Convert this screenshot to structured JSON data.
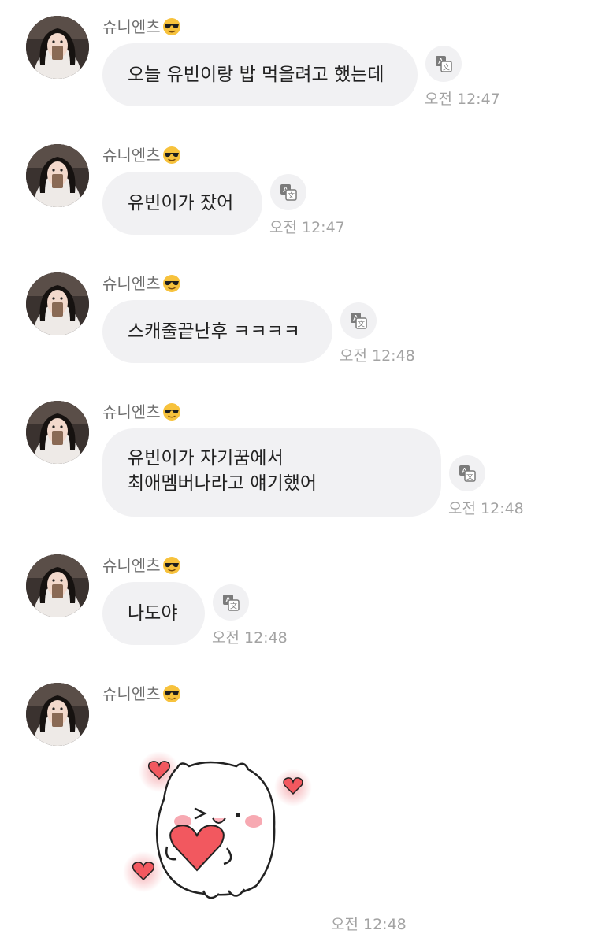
{
  "messages": [
    {
      "sender": "슈니엔츠",
      "text": "오늘 유빈이랑 밥 먹을려고 했는데",
      "time": "오전 12:47"
    },
    {
      "sender": "슈니엔츠",
      "text": "유빈이가 잤어",
      "time": "오전 12:47"
    },
    {
      "sender": "슈니엔츠",
      "text": "스캐줄끝난후 ㅋㅋㅋㅋ",
      "time": "오전 12:48"
    },
    {
      "sender": "슈니엔츠",
      "text": "유빈이가 자기꿈에서\n최애멤버나라고 얘기했어",
      "time": "오전 12:48"
    },
    {
      "sender": "슈니엔츠",
      "text": "나도야",
      "time": "오전 12:48"
    },
    {
      "sender": "슈니엔츠",
      "sticker": "bear-hugging-heart-sticker",
      "time": "오전 12:48"
    }
  ],
  "icons": {
    "translate": "translate-icon",
    "emoji": "sunglasses-emoji"
  },
  "colors": {
    "bubble": "#f1f1f3",
    "timestamp": "#a3a3a3",
    "heart": "#f2585f"
  }
}
